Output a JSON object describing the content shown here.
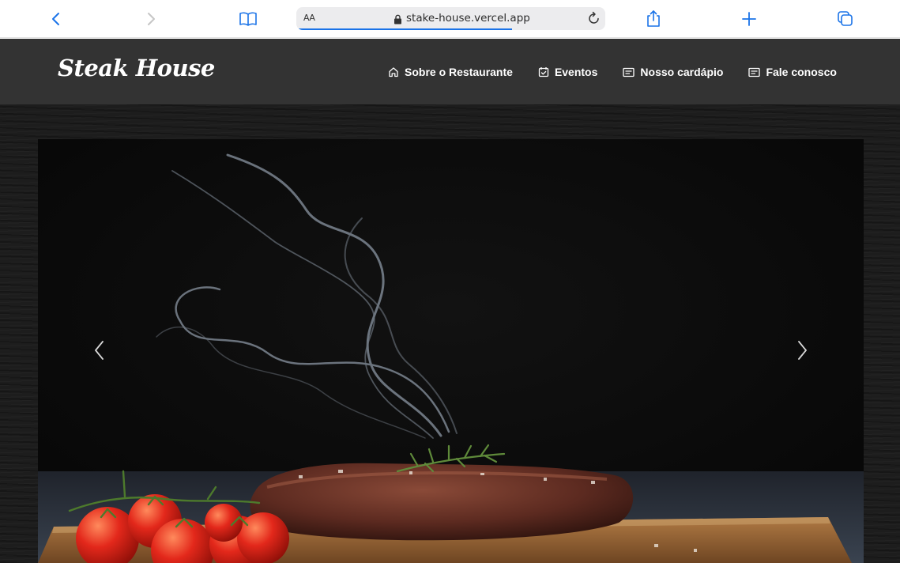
{
  "browser": {
    "reader_label": "AA",
    "url": "stake-house.vercel.app",
    "load_progress": 0.7
  },
  "site": {
    "brand": "Steak House",
    "nav": [
      {
        "label": "Sobre o Restaurante",
        "icon": "home-icon"
      },
      {
        "label": "Eventos",
        "icon": "calendar-check-icon"
      },
      {
        "label": "Nosso cardápio",
        "icon": "list-icon"
      },
      {
        "label": "Fale conosco",
        "icon": "list-icon"
      }
    ]
  },
  "carousel": {
    "slide": "grilled steak with rosemary, cherry tomatoes and smoke on a wooden board",
    "prev_icon": "chevron-left-icon",
    "next_icon": "chevron-right-icon"
  },
  "colors": {
    "accent": "#1a73e8",
    "header_bg": "#333333",
    "page_bg": "#1d1d1d"
  }
}
